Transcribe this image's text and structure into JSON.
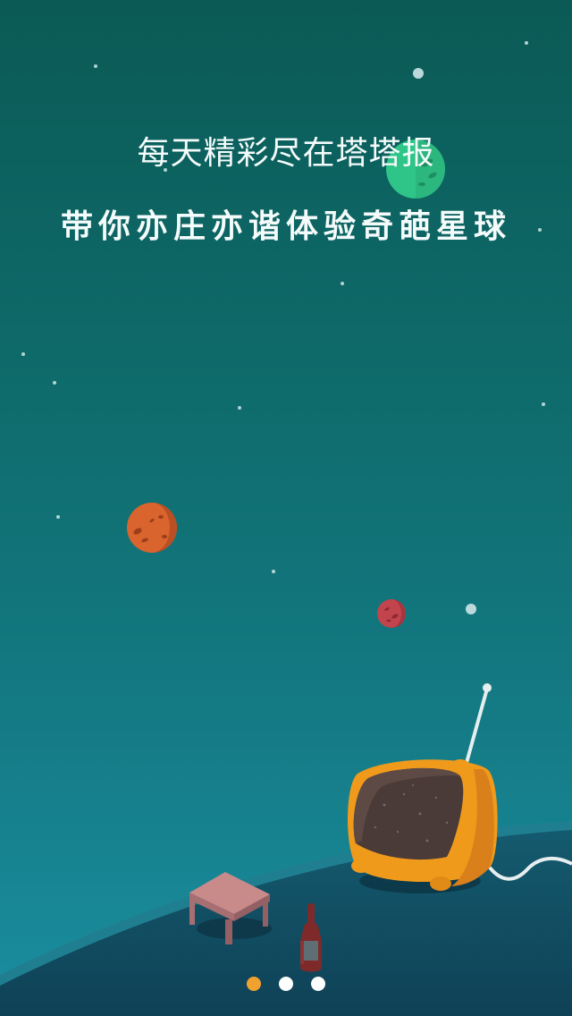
{
  "onboarding": {
    "headline": "每天精彩尽在塔塔报",
    "subheadline": "带你亦庄亦谐体验奇葩星球",
    "page_indicator": {
      "current": 1,
      "total": 3
    }
  },
  "illustration": {
    "objects": [
      "green-planet",
      "orange-planet",
      "red-planet",
      "retro-tv",
      "stool",
      "bottle",
      "planet-surface"
    ]
  },
  "colors": {
    "background_top": "#0b5a56",
    "background_bottom": "#1a8ea0",
    "accent_orange": "#f0a231",
    "indicator_inactive": "#ffffff"
  }
}
